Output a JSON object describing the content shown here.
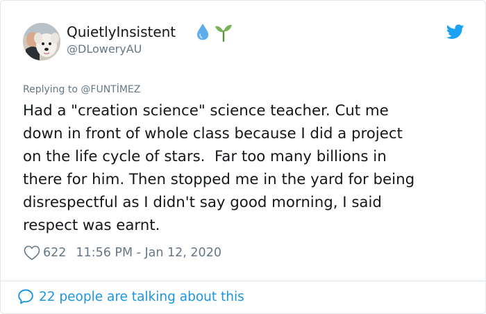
{
  "author": {
    "display_name": "QuietlyInsistent",
    "handle": "@DLoweryAU",
    "name_emojis": [
      "droplet-icon",
      "seedling-icon"
    ]
  },
  "reply_context": {
    "prefix": "Replying to",
    "mention": "@FUNTİMEZ"
  },
  "tweet": {
    "text_lines": [
      "Had a \"creation science\" science teacher. Cut me",
      "down in front of whole class because I did a project",
      "on the life cycle of stars.  Far too many billions in",
      "there for him. Then stopped me in the yard for being",
      "disrespectful as I didn't say good morning, I said",
      "respect was earnt."
    ]
  },
  "metrics": {
    "likes": "622",
    "timestamp": "11:56 PM - Jan 12, 2020"
  },
  "footer": {
    "talking": "22 people are talking about this"
  },
  "colors": {
    "text": "#14171a",
    "secondary": "#657786",
    "accent": "#1b95e0",
    "twitter_blue": "#1da1f2",
    "border": "#e1e8ed"
  }
}
